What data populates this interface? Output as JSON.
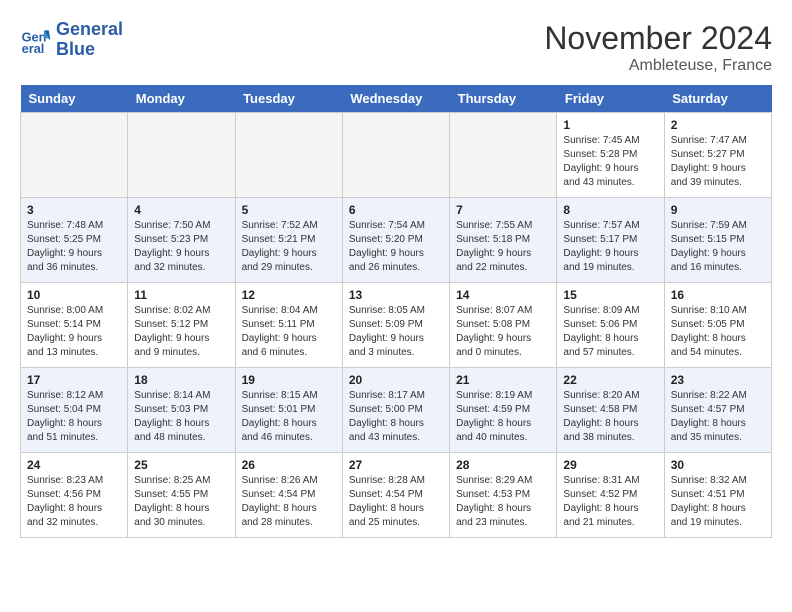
{
  "header": {
    "logo_line1": "General",
    "logo_line2": "Blue",
    "month_title": "November 2024",
    "location": "Ambleteuse, France"
  },
  "days_of_week": [
    "Sunday",
    "Monday",
    "Tuesday",
    "Wednesday",
    "Thursday",
    "Friday",
    "Saturday"
  ],
  "weeks": [
    [
      {
        "num": "",
        "info": ""
      },
      {
        "num": "",
        "info": ""
      },
      {
        "num": "",
        "info": ""
      },
      {
        "num": "",
        "info": ""
      },
      {
        "num": "",
        "info": ""
      },
      {
        "num": "1",
        "info": "Sunrise: 7:45 AM\nSunset: 5:28 PM\nDaylight: 9 hours\nand 43 minutes."
      },
      {
        "num": "2",
        "info": "Sunrise: 7:47 AM\nSunset: 5:27 PM\nDaylight: 9 hours\nand 39 minutes."
      }
    ],
    [
      {
        "num": "3",
        "info": "Sunrise: 7:48 AM\nSunset: 5:25 PM\nDaylight: 9 hours\nand 36 minutes."
      },
      {
        "num": "4",
        "info": "Sunrise: 7:50 AM\nSunset: 5:23 PM\nDaylight: 9 hours\nand 32 minutes."
      },
      {
        "num": "5",
        "info": "Sunrise: 7:52 AM\nSunset: 5:21 PM\nDaylight: 9 hours\nand 29 minutes."
      },
      {
        "num": "6",
        "info": "Sunrise: 7:54 AM\nSunset: 5:20 PM\nDaylight: 9 hours\nand 26 minutes."
      },
      {
        "num": "7",
        "info": "Sunrise: 7:55 AM\nSunset: 5:18 PM\nDaylight: 9 hours\nand 22 minutes."
      },
      {
        "num": "8",
        "info": "Sunrise: 7:57 AM\nSunset: 5:17 PM\nDaylight: 9 hours\nand 19 minutes."
      },
      {
        "num": "9",
        "info": "Sunrise: 7:59 AM\nSunset: 5:15 PM\nDaylight: 9 hours\nand 16 minutes."
      }
    ],
    [
      {
        "num": "10",
        "info": "Sunrise: 8:00 AM\nSunset: 5:14 PM\nDaylight: 9 hours\nand 13 minutes."
      },
      {
        "num": "11",
        "info": "Sunrise: 8:02 AM\nSunset: 5:12 PM\nDaylight: 9 hours\nand 9 minutes."
      },
      {
        "num": "12",
        "info": "Sunrise: 8:04 AM\nSunset: 5:11 PM\nDaylight: 9 hours\nand 6 minutes."
      },
      {
        "num": "13",
        "info": "Sunrise: 8:05 AM\nSunset: 5:09 PM\nDaylight: 9 hours\nand 3 minutes."
      },
      {
        "num": "14",
        "info": "Sunrise: 8:07 AM\nSunset: 5:08 PM\nDaylight: 9 hours\nand 0 minutes."
      },
      {
        "num": "15",
        "info": "Sunrise: 8:09 AM\nSunset: 5:06 PM\nDaylight: 8 hours\nand 57 minutes."
      },
      {
        "num": "16",
        "info": "Sunrise: 8:10 AM\nSunset: 5:05 PM\nDaylight: 8 hours\nand 54 minutes."
      }
    ],
    [
      {
        "num": "17",
        "info": "Sunrise: 8:12 AM\nSunset: 5:04 PM\nDaylight: 8 hours\nand 51 minutes."
      },
      {
        "num": "18",
        "info": "Sunrise: 8:14 AM\nSunset: 5:03 PM\nDaylight: 8 hours\nand 48 minutes."
      },
      {
        "num": "19",
        "info": "Sunrise: 8:15 AM\nSunset: 5:01 PM\nDaylight: 8 hours\nand 46 minutes."
      },
      {
        "num": "20",
        "info": "Sunrise: 8:17 AM\nSunset: 5:00 PM\nDaylight: 8 hours\nand 43 minutes."
      },
      {
        "num": "21",
        "info": "Sunrise: 8:19 AM\nSunset: 4:59 PM\nDaylight: 8 hours\nand 40 minutes."
      },
      {
        "num": "22",
        "info": "Sunrise: 8:20 AM\nSunset: 4:58 PM\nDaylight: 8 hours\nand 38 minutes."
      },
      {
        "num": "23",
        "info": "Sunrise: 8:22 AM\nSunset: 4:57 PM\nDaylight: 8 hours\nand 35 minutes."
      }
    ],
    [
      {
        "num": "24",
        "info": "Sunrise: 8:23 AM\nSunset: 4:56 PM\nDaylight: 8 hours\nand 32 minutes."
      },
      {
        "num": "25",
        "info": "Sunrise: 8:25 AM\nSunset: 4:55 PM\nDaylight: 8 hours\nand 30 minutes."
      },
      {
        "num": "26",
        "info": "Sunrise: 8:26 AM\nSunset: 4:54 PM\nDaylight: 8 hours\nand 28 minutes."
      },
      {
        "num": "27",
        "info": "Sunrise: 8:28 AM\nSunset: 4:54 PM\nDaylight: 8 hours\nand 25 minutes."
      },
      {
        "num": "28",
        "info": "Sunrise: 8:29 AM\nSunset: 4:53 PM\nDaylight: 8 hours\nand 23 minutes."
      },
      {
        "num": "29",
        "info": "Sunrise: 8:31 AM\nSunset: 4:52 PM\nDaylight: 8 hours\nand 21 minutes."
      },
      {
        "num": "30",
        "info": "Sunrise: 8:32 AM\nSunset: 4:51 PM\nDaylight: 8 hours\nand 19 minutes."
      }
    ]
  ]
}
